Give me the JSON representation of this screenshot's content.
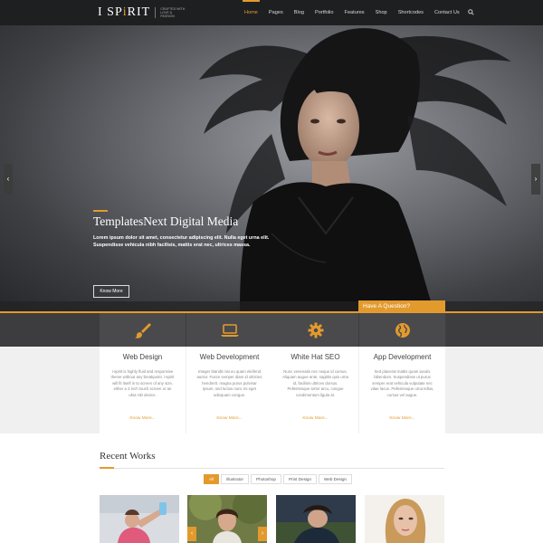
{
  "header": {
    "logo_main": "I SP",
    "logo_accent": "i",
    "logo_end": "RIT",
    "logo_tagline": "CRAFTED WITH LOVE & PASSION",
    "nav": [
      "Home",
      "Pages",
      "Blog",
      "Portfolio",
      "Features",
      "Shop",
      "Shortcodes",
      "Contact Us"
    ],
    "active_nav": "Home",
    "search_icon": "search-icon"
  },
  "hero": {
    "title": "TemplatesNext Digital Media",
    "text": "Lorem ipsum dolor sit amet, consectetur adipiscing elit. Nulla eget urna elit. Suspendisse vehicula nibh facilisis, mattis erat nec, ultrices massa.",
    "button": "Know More",
    "prev": "‹",
    "next": "›"
  },
  "question_tab": "Have A Question?",
  "services": [
    {
      "icon": "paintbrush-icon",
      "title": "Web Design",
      "desc": "i-spirit is highly fluid and responsive theme without any breakpoint. i-spirit will fit itself in to screen of any size, either a 3 inch touch screen or an ultra HD device.",
      "more": "Know More..."
    },
    {
      "icon": "laptop-icon",
      "title": "Web Development",
      "desc": "Integer blandit nisi eu quam eleifend auctor. Fusce semper diam id ultricies hendrerit. magna purus pulvinar ipsum, sed luctus nunc mi eget odioquam congue.",
      "more": "Know More..."
    },
    {
      "icon": "gear-icon",
      "title": "White Hat SEO",
      "desc": "Nunc venenatis nec neque id cursus. Aliquam augue ante, sagittis quis urna id, facilisis ultrices dorsus. Pellentesque tortor arcu, congue condimentum ligula at.",
      "more": "Know More..."
    },
    {
      "icon": "globe-icon",
      "title": "App Development",
      "desc": "Sed placerat mattis quam iaculis bibendum. Suspendisse ut purus semper erat vehicula vulputate nec vitae lacus. Pellentesque urna tellus, cursus vel augue.",
      "more": "Know More..."
    }
  ],
  "recent_works": {
    "title": "Recent Works",
    "filters": [
      "All",
      "Illustrator",
      "Photoshop",
      "Print Design",
      "Web Design"
    ],
    "active_filter": "All",
    "prev": "‹",
    "next": "›"
  },
  "colors": {
    "accent": "#e39a2d",
    "header_bg": "#1e1f21",
    "service_bar": "#3d3d3f"
  }
}
